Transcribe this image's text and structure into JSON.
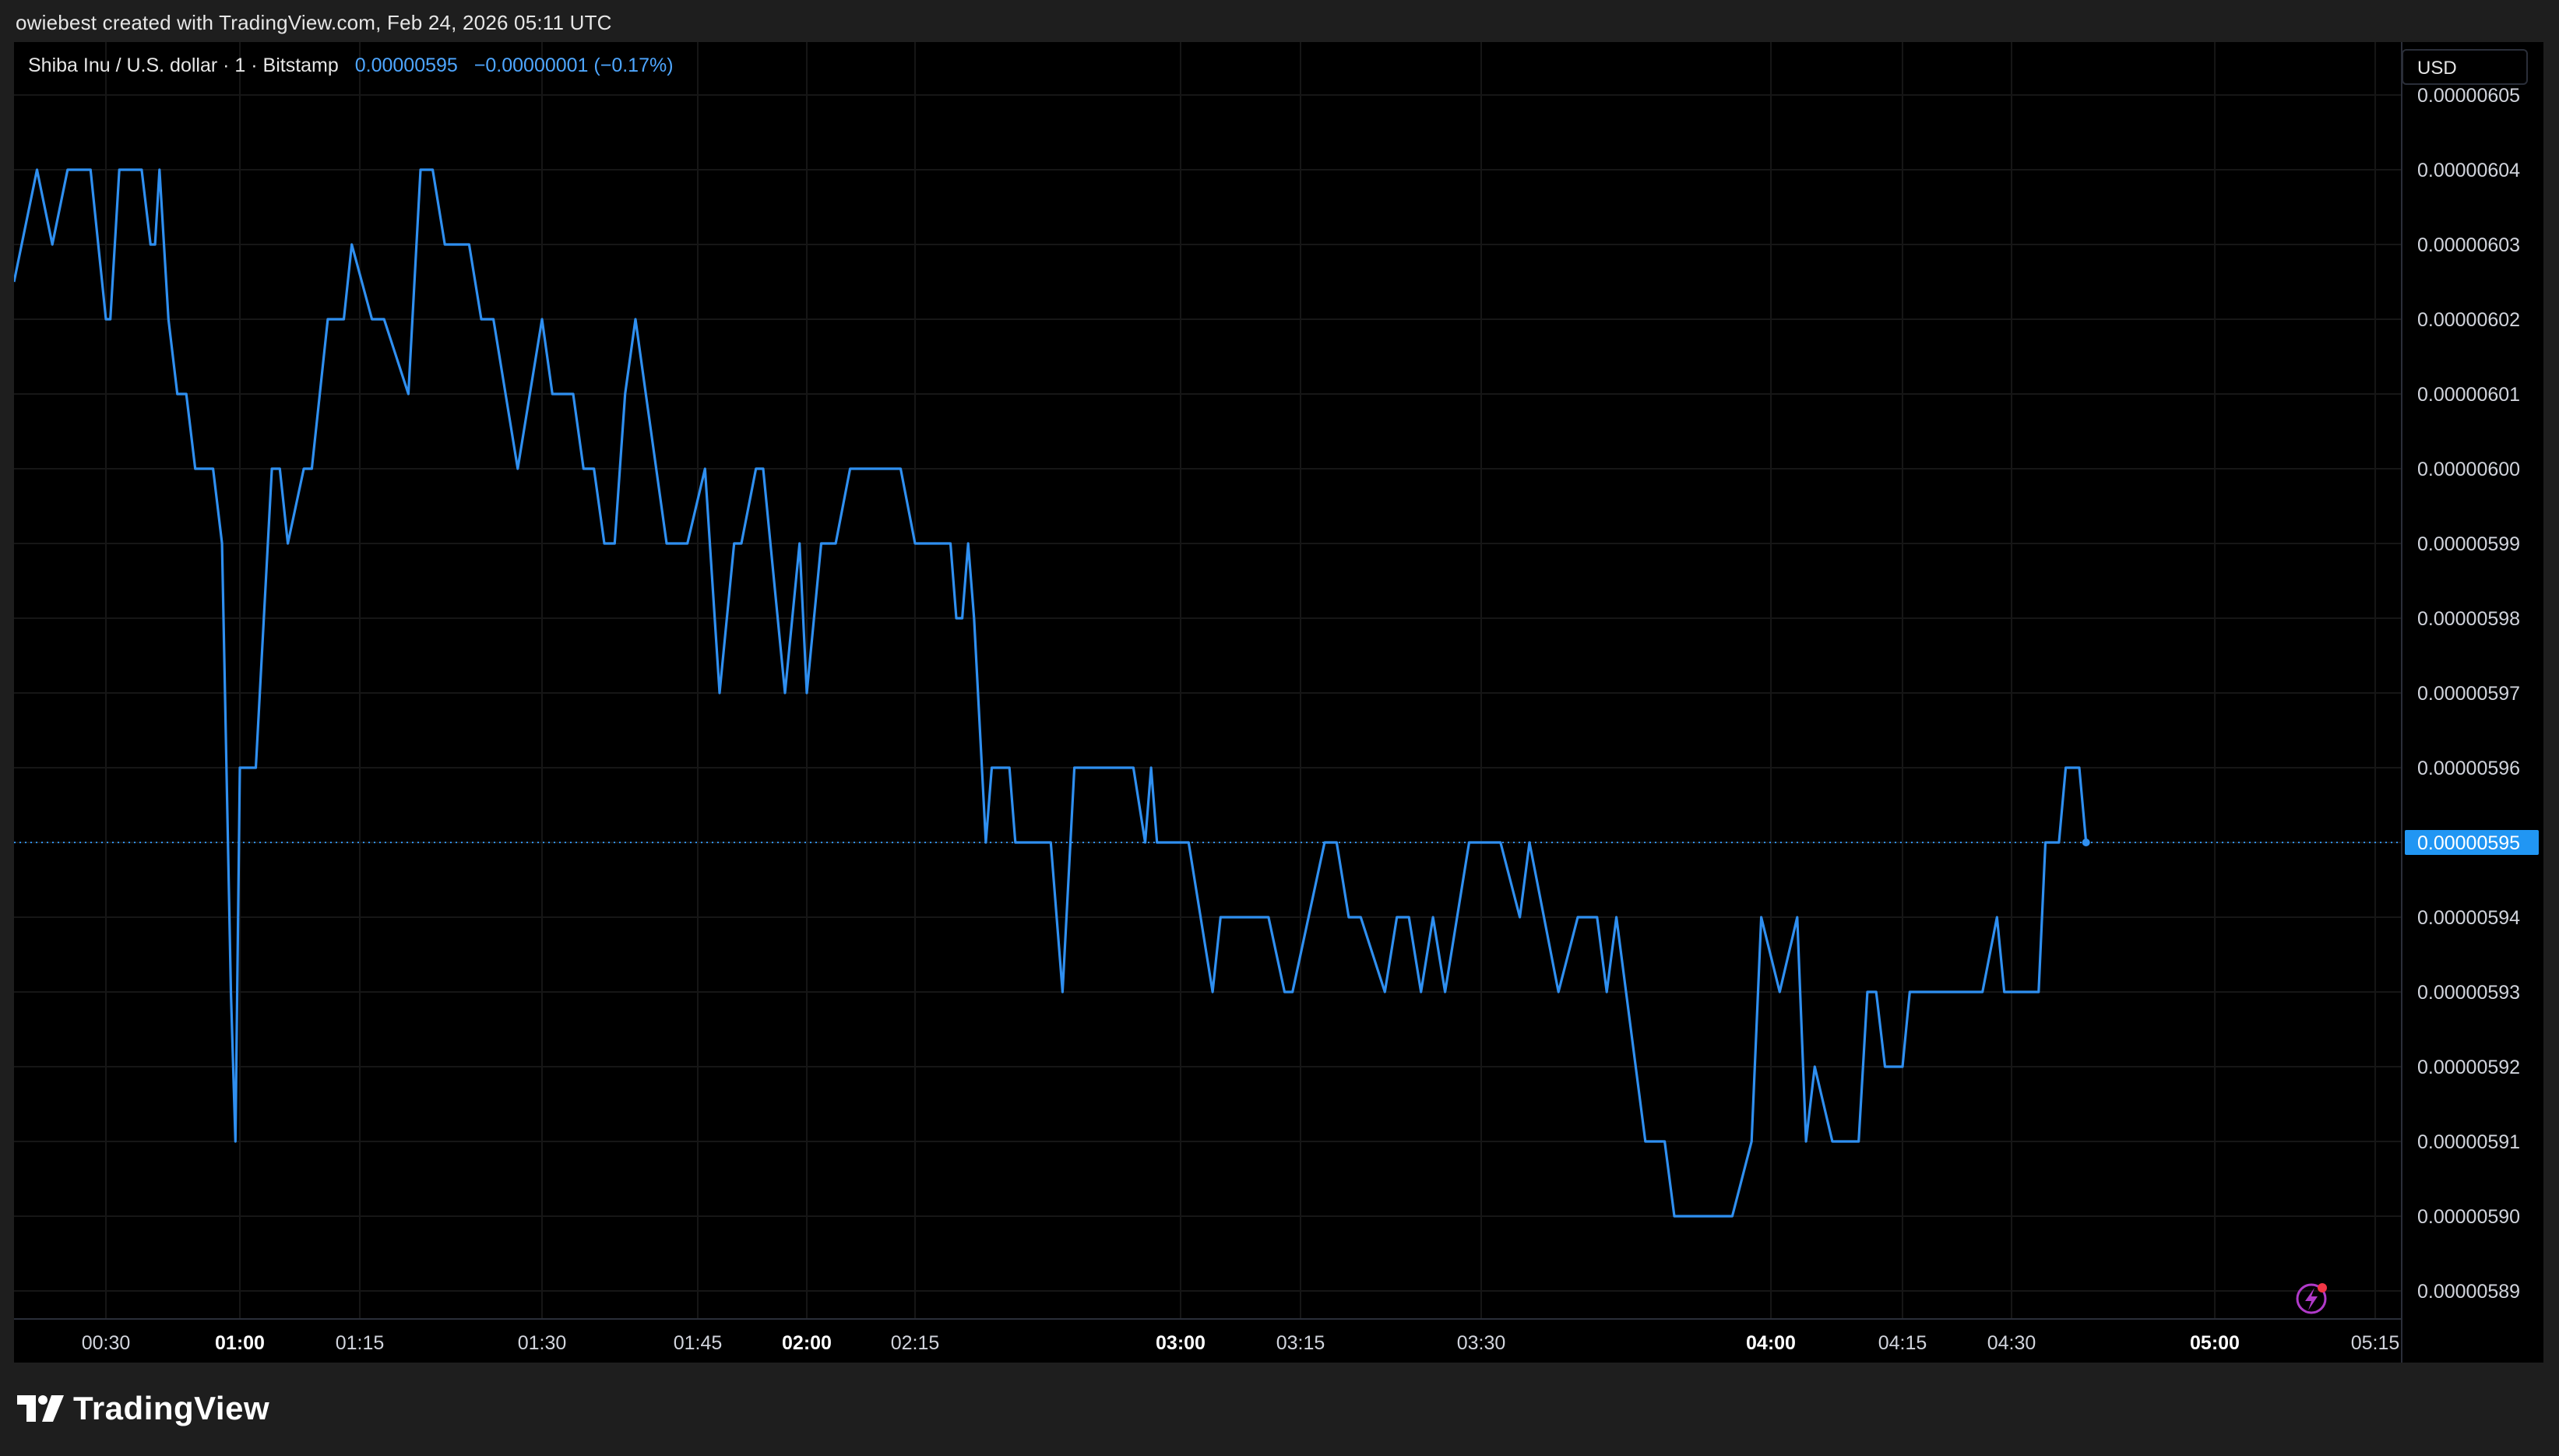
{
  "caption": "owiebest created with TradingView.com, Feb 24, 2026 05:11 UTC",
  "legend": {
    "symbol": "Shiba Inu / U.S. dollar · 1 · Bitstamp",
    "last_price": "0.00000595",
    "change": "−0.00000001 (−0.17%)"
  },
  "currency_button": "USD",
  "brand": "TradingView",
  "colors": {
    "line": "#2f8ff0",
    "price_label_bg": "#2196f3",
    "grid": "#1a1a1a",
    "background": "#000000",
    "frame": "#1e1e1e"
  },
  "icons": {
    "bolt": "lightning-bolt-icon"
  },
  "chart_data": {
    "type": "line",
    "ylim": [
      5.885e-06,
      6.055e-06
    ],
    "xlim": [
      "00:18",
      "05:25"
    ],
    "y_ticks": [
      "0.00000605",
      "0.00000604",
      "0.00000603",
      "0.00000602",
      "0.00000601",
      "0.00000600",
      "0.00000599",
      "0.00000598",
      "0.00000597",
      "0.00000596",
      "0.00000595",
      "0.00000594",
      "0.00000593",
      "0.00000592",
      "0.00000591",
      "0.00000590",
      "0.00000589"
    ],
    "x_ticks": [
      {
        "t": "00:30",
        "bold": false
      },
      {
        "t": "01:00",
        "bold": true
      },
      {
        "t": "01:15",
        "bold": false
      },
      {
        "t": "01:30",
        "bold": false
      },
      {
        "t": "01:45",
        "bold": false
      },
      {
        "t": "02:00",
        "bold": true
      },
      {
        "t": "02:15",
        "bold": false
      },
      {
        "t": "03:00",
        "bold": true
      },
      {
        "t": "03:15",
        "bold": false
      },
      {
        "t": "03:30",
        "bold": false
      },
      {
        "t": "04:00",
        "bold": true
      },
      {
        "t": "04:15",
        "bold": false
      },
      {
        "t": "04:30",
        "bold": false
      },
      {
        "t": "05:00",
        "bold": true
      },
      {
        "t": "05:15",
        "bold": false
      }
    ],
    "current_price_label": "0.00000595",
    "current_price": 5.95e-06,
    "series": [
      {
        "points": [
          [
            "00:18",
            602.5
          ],
          [
            "00:21",
            604
          ],
          [
            "00:23",
            603
          ],
          [
            "00:25",
            604
          ],
          [
            "00:28",
            604
          ],
          [
            "00:30",
            602
          ],
          [
            "00:31",
            602
          ],
          [
            "00:33",
            604
          ],
          [
            "00:38",
            604
          ],
          [
            "00:40",
            603
          ],
          [
            "00:41",
            603
          ],
          [
            "00:42",
            604
          ],
          [
            "00:44",
            602
          ],
          [
            "00:46",
            601
          ],
          [
            "00:48",
            601
          ],
          [
            "00:50",
            600
          ],
          [
            "00:54",
            600
          ],
          [
            "00:56",
            599
          ],
          [
            "00:58",
            593
          ],
          [
            "00:59",
            591
          ],
          [
            "01:00",
            596
          ],
          [
            "01:02",
            596
          ],
          [
            "01:04",
            600
          ],
          [
            "01:05",
            600
          ],
          [
            "01:06",
            599
          ],
          [
            "01:08",
            600
          ],
          [
            "01:09",
            600
          ],
          [
            "01:11",
            602
          ],
          [
            "01:13",
            602
          ],
          [
            "01:14",
            603
          ],
          [
            "01:16",
            602
          ],
          [
            "01:17",
            602
          ],
          [
            "01:19",
            601
          ],
          [
            "01:20",
            604
          ],
          [
            "01:21",
            604
          ],
          [
            "01:22",
            603
          ],
          [
            "01:24",
            603
          ],
          [
            "01:25",
            602
          ],
          [
            "01:26",
            602
          ],
          [
            "01:28",
            600
          ],
          [
            "01:30",
            602
          ],
          [
            "01:31",
            601
          ],
          [
            "01:33",
            601
          ],
          [
            "01:34",
            600
          ],
          [
            "01:35",
            600
          ],
          [
            "01:36",
            599
          ],
          [
            "01:37",
            599
          ],
          [
            "01:38",
            601
          ],
          [
            "01:39",
            602
          ],
          [
            "01:40",
            601
          ],
          [
            "01:42",
            599
          ],
          [
            "01:44",
            599
          ],
          [
            "01:46",
            600
          ],
          [
            "01:48",
            597
          ],
          [
            "01:50",
            599
          ],
          [
            "01:51",
            599
          ],
          [
            "01:53",
            600
          ],
          [
            "01:54",
            600
          ],
          [
            "01:55",
            599
          ],
          [
            "01:57",
            597
          ],
          [
            "01:59",
            599
          ],
          [
            "02:00",
            597
          ],
          [
            "02:02",
            599
          ],
          [
            "02:04",
            599
          ],
          [
            "02:06",
            600
          ],
          [
            "02:13",
            600
          ],
          [
            "02:15",
            599
          ],
          [
            "02:21",
            599
          ],
          [
            "02:22",
            598
          ],
          [
            "02:23",
            598
          ],
          [
            "02:24",
            599
          ],
          [
            "02:25",
            598
          ],
          [
            "02:27",
            595
          ],
          [
            "02:28",
            596
          ],
          [
            "02:31",
            596
          ],
          [
            "02:32",
            595
          ],
          [
            "02:38",
            595
          ],
          [
            "02:40",
            593
          ],
          [
            "02:42",
            596
          ],
          [
            "02:48",
            596
          ],
          [
            "02:52",
            596
          ],
          [
            "02:54",
            595
          ],
          [
            "02:55",
            596
          ],
          [
            "02:56",
            595
          ],
          [
            "03:01",
            595
          ],
          [
            "03:04",
            593
          ],
          [
            "03:05",
            594
          ],
          [
            "03:11",
            594
          ],
          [
            "03:13",
            593
          ],
          [
            "03:14",
            593
          ],
          [
            "03:17",
            595
          ],
          [
            "03:18",
            595
          ],
          [
            "03:19",
            594
          ],
          [
            "03:20",
            594
          ],
          [
            "03:22",
            593
          ],
          [
            "03:23",
            594
          ],
          [
            "03:24",
            594
          ],
          [
            "03:25",
            593
          ],
          [
            "03:26",
            594
          ],
          [
            "03:27",
            593
          ],
          [
            "03:29",
            595
          ],
          [
            "03:32",
            595
          ],
          [
            "03:34",
            594
          ],
          [
            "03:35",
            595
          ],
          [
            "03:38",
            593
          ],
          [
            "03:40",
            594
          ],
          [
            "03:42",
            594
          ],
          [
            "03:43",
            593
          ],
          [
            "03:44",
            594
          ],
          [
            "03:45",
            593
          ],
          [
            "03:47",
            591
          ],
          [
            "03:49",
            591
          ],
          [
            "03:50",
            590
          ],
          [
            "03:56",
            590
          ],
          [
            "03:58",
            591
          ],
          [
            "03:59",
            594
          ],
          [
            "04:01",
            593
          ],
          [
            "04:03",
            594
          ],
          [
            "04:04",
            591
          ],
          [
            "04:05",
            592
          ],
          [
            "04:07",
            591
          ],
          [
            "04:10",
            591
          ],
          [
            "04:11",
            593
          ],
          [
            "04:12",
            593
          ],
          [
            "04:13",
            592
          ],
          [
            "04:15",
            592
          ],
          [
            "04:16",
            593
          ],
          [
            "04:26",
            593
          ],
          [
            "04:28",
            594
          ],
          [
            "04:29",
            593
          ],
          [
            "04:34",
            593
          ],
          [
            "04:35",
            595
          ],
          [
            "04:37",
            595
          ],
          [
            "04:38",
            596
          ],
          [
            "04:40",
            596
          ],
          [
            "04:41",
            595
          ]
        ],
        "time_map": {
          "comment_axis_anchor": "tick labels are not evenly spaced; x positions follow printed tick times"
        }
      }
    ]
  }
}
